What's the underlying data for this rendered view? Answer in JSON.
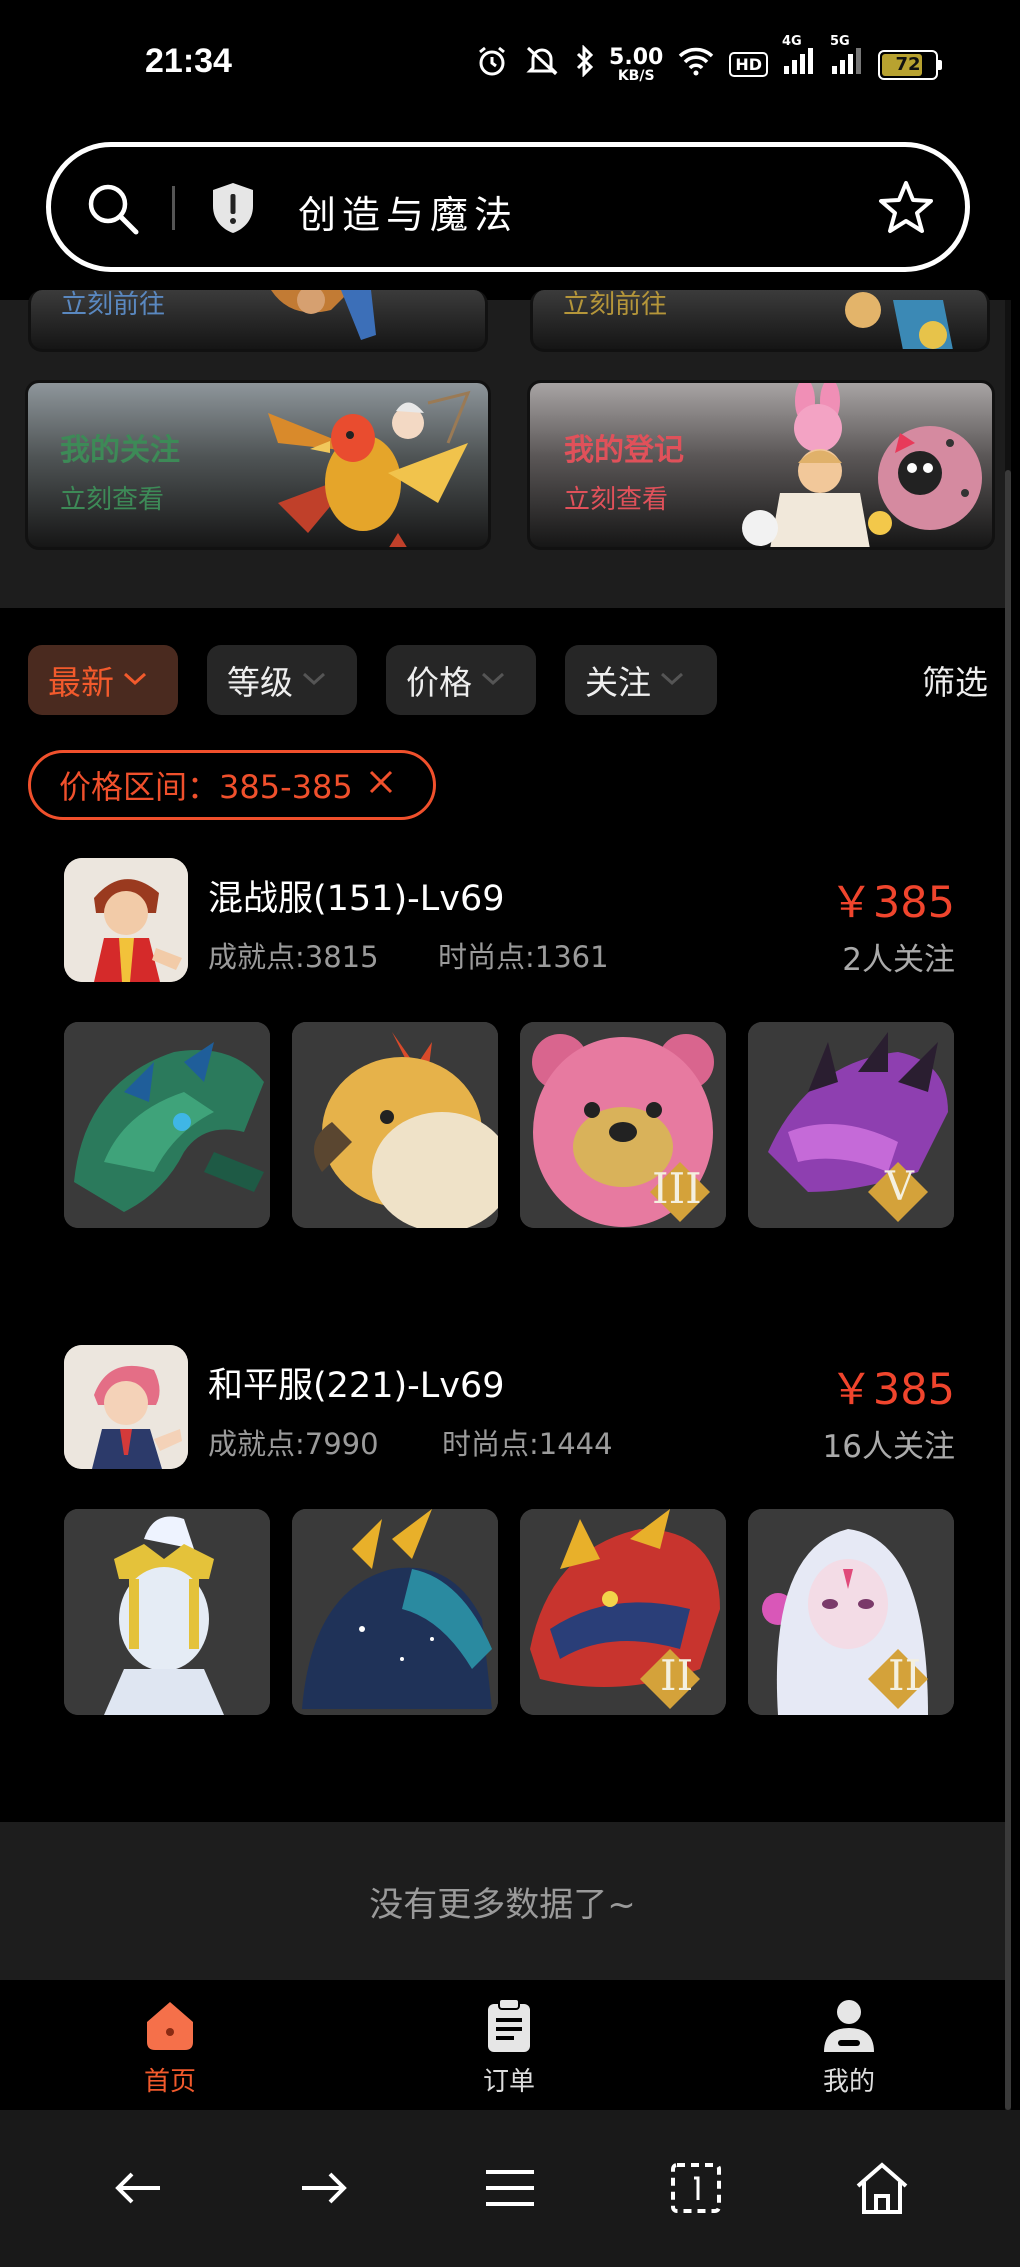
{
  "status_bar": {
    "time": "21:34",
    "speed_value": "5.00",
    "speed_unit": "KB/S",
    "hd_badge": "HD",
    "signal_4g": "4G",
    "signal_5g": "5G",
    "battery_level": "72",
    "icons": [
      "alarm-icon",
      "mute-icon",
      "bluetooth-icon",
      "wifi-icon",
      "signal-icon",
      "battery-icon"
    ]
  },
  "search": {
    "query": "创造与魔法",
    "icons": [
      "search-icon",
      "shield-icon",
      "star-icon"
    ]
  },
  "banners": {
    "top_left_sub": "立刻前往",
    "top_right_sub": "立刻前往",
    "bottom_left": {
      "title": "我的关注",
      "sub": "立刻查看"
    },
    "bottom_right": {
      "title": "我的登记",
      "sub": "立刻查看"
    }
  },
  "filters": {
    "sort_options": [
      "最新",
      "等级",
      "价格",
      "关注"
    ],
    "active_index": 0,
    "filter_label": "筛选",
    "price_range_label": "价格区间：385-385"
  },
  "listings": [
    {
      "title": "混战服(151)-Lv69",
      "achievement": "成就点:3815",
      "fashion": "时尚点:1361",
      "price": "￥385",
      "followers": "2人关注",
      "thumbnails": [
        {
          "name": "green-dragon-mount",
          "badge": ""
        },
        {
          "name": "phoenix-bird-mount",
          "badge": ""
        },
        {
          "name": "pink-bear-pet",
          "badge": "III"
        },
        {
          "name": "purple-dragon-mount",
          "badge": "V"
        }
      ]
    },
    {
      "title": "和平服(221)-Lv69",
      "achievement": "成就点:7990",
      "fashion": "时尚点:1444",
      "price": "￥385",
      "followers": "16人关注",
      "thumbnails": [
        {
          "name": "golden-crown-outfit",
          "badge": ""
        },
        {
          "name": "starry-horse-mount",
          "badge": ""
        },
        {
          "name": "golden-dragon-mount",
          "badge": "II"
        },
        {
          "name": "white-hair-outfit",
          "badge": "II"
        }
      ]
    }
  ],
  "no_more_text": "没有更多数据了~",
  "tabbar": {
    "items": [
      {
        "label": "首页",
        "icon": "home-icon",
        "active": true
      },
      {
        "label": "订单",
        "icon": "clipboard-icon",
        "active": false
      },
      {
        "label": "我的",
        "icon": "user-icon",
        "active": false
      }
    ]
  },
  "system_nav": {
    "icons": [
      "back-arrow-icon",
      "forward-arrow-icon",
      "menu-icon",
      "tabs-icon",
      "home-outline-icon"
    ]
  },
  "colors": {
    "accent": "#f25a2c",
    "price": "#f0452d",
    "follow_title": "#3d8a57",
    "register_title": "#e0515a"
  }
}
